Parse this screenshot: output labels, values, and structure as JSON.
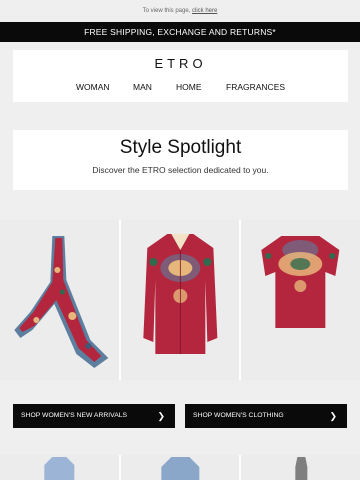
{
  "preheader": {
    "text": "To view this page, ",
    "link": "click here"
  },
  "banner": {
    "text": "FREE SHIPPING, EXCHANGE AND RETURNS*"
  },
  "header": {
    "logo": "ETRO",
    "nav": [
      "WOMAN",
      "MAN",
      "HOME",
      "FRAGRANCES"
    ]
  },
  "spotlight": {
    "title": "Style Spotlight",
    "subtitle": "Discover the ETRO selection dedicated to you."
  },
  "products": [
    {
      "icon": "paisley-scarf-image"
    },
    {
      "icon": "paisley-shirt-image"
    },
    {
      "icon": "paisley-tshirt-image"
    }
  ],
  "ctas": [
    {
      "label": "SHOP WOMEN'S NEW ARRIVALS",
      "arrow": "❯"
    },
    {
      "label": "SHOP WOMEN'S CLOTHING",
      "arrow": "❯"
    }
  ],
  "colors": {
    "banner": "#0a0a0a",
    "product_red": "#b3263d",
    "accent_blue": "#5c7fa0"
  }
}
